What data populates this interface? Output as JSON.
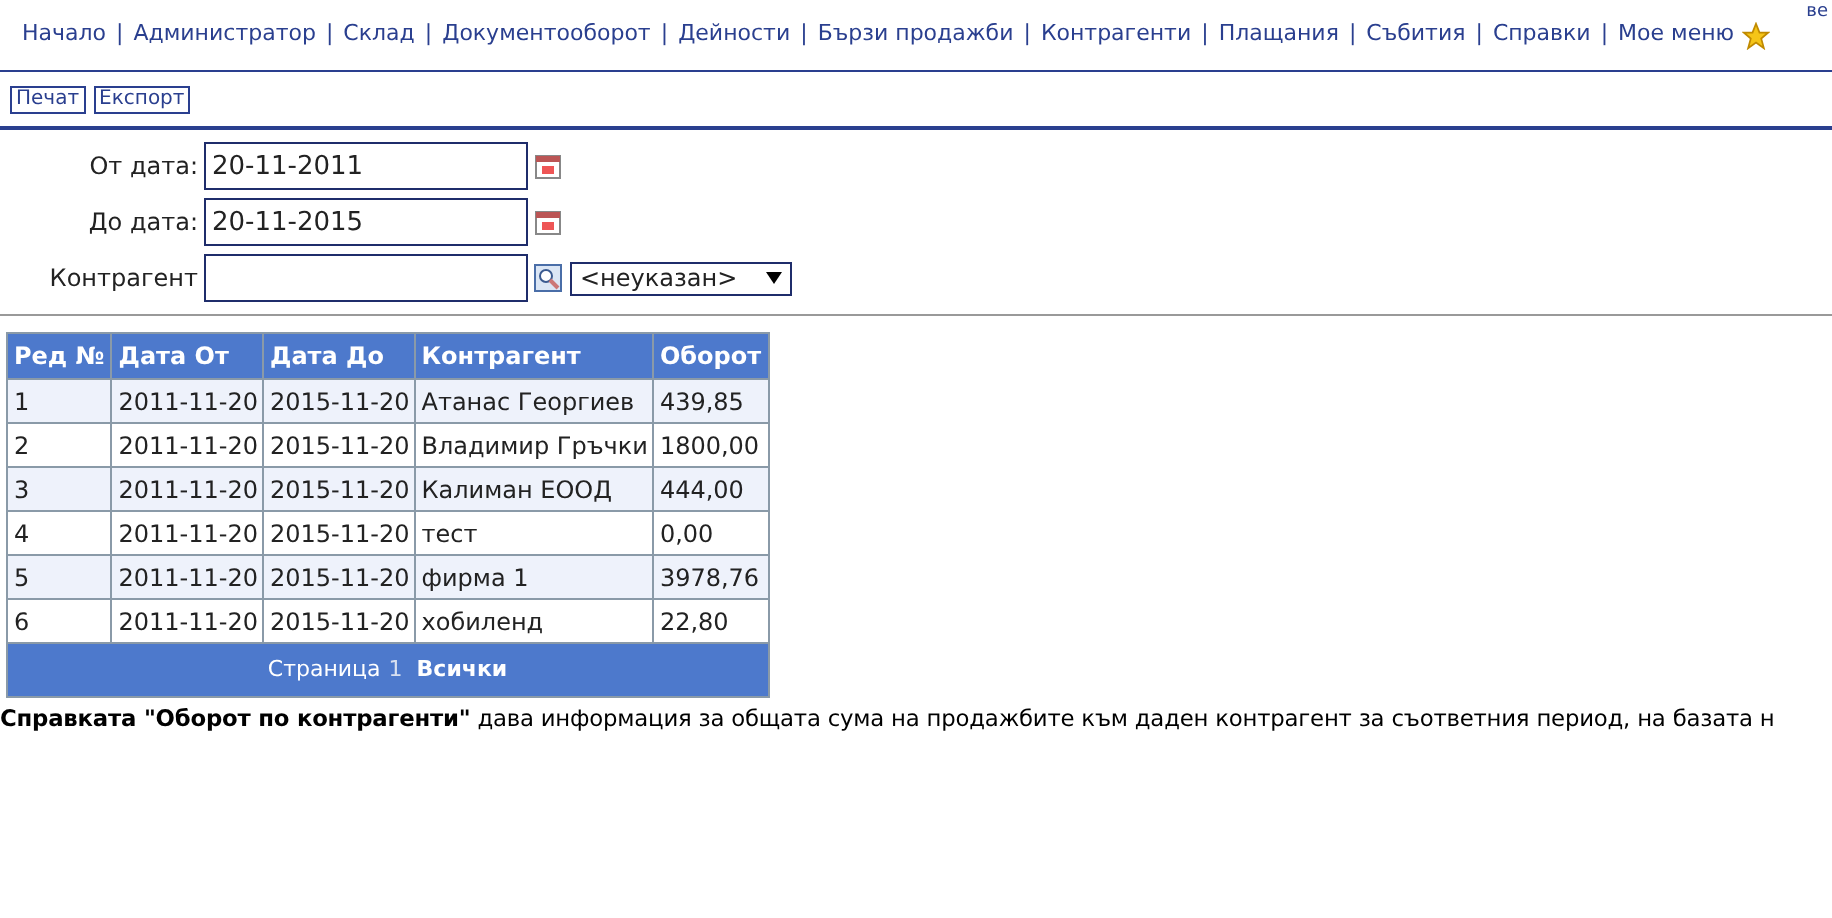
{
  "corner_text": "ве",
  "nav_separator": "|",
  "nav": [
    "Начало",
    "Администратор",
    "Склад",
    "Документооборот",
    "Дейности",
    "Бързи продажби",
    "Контрагенти",
    "Плащания",
    "Събития",
    "Справки",
    "Мое меню"
  ],
  "toolbar": [
    "Печат",
    "Експорт"
  ],
  "form": [
    {
      "label": "От дата:",
      "value": "20-11-2011",
      "kind": "date"
    },
    {
      "label": "До дата:",
      "value": "20-11-2015",
      "kind": "date"
    },
    {
      "label": "Контрагент",
      "kind": "lookup",
      "select": "<неуказан>"
    }
  ],
  "table": {
    "columns": [
      "Ред №",
      "Дата От",
      "Дата До",
      "Контрагент",
      "Оборот"
    ],
    "rows": [
      [
        "1",
        "2011-11-20",
        "2015-11-20",
        "Атанас Георгиев",
        "439,85"
      ],
      [
        "2",
        "2011-11-20",
        "2015-11-20",
        "Владимир Гръчки",
        "1800,00"
      ],
      [
        "3",
        "2011-11-20",
        "2015-11-20",
        "Калиман ЕООД",
        "444,00"
      ],
      [
        "4",
        "2011-11-20",
        "2015-11-20",
        "тест",
        "0,00"
      ],
      [
        "5",
        "2011-11-20",
        "2015-11-20",
        "фирма 1",
        "3978,76"
      ],
      [
        "6",
        "2011-11-20",
        "2015-11-20",
        "хобиленд",
        "22,80"
      ]
    ],
    "pager": {
      "label": "Страница",
      "page": "1",
      "all": "Всички"
    }
  },
  "description": "**Справката \"Оборот по контрагенти\"** дава информация за общата сума на продажбите към даден контрагент за съответния период, на базата н"
}
